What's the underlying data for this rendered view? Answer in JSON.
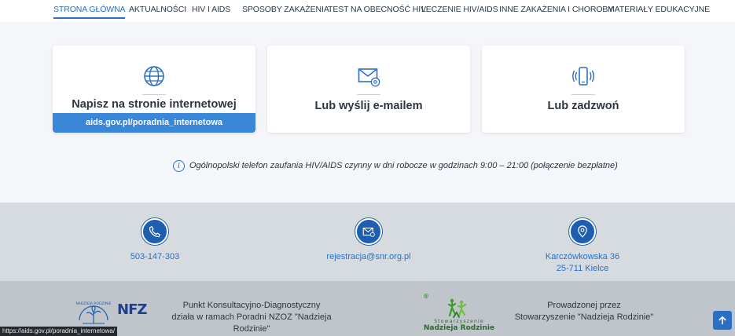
{
  "nav": {
    "items": [
      {
        "label": "STRONA GŁÓWNA",
        "active": true
      },
      {
        "label": "AKTUALNOŚCI"
      },
      {
        "label": "HIV I AIDS"
      },
      {
        "label": "SPOSOBY ZAKAŻENIA"
      },
      {
        "label": "TEST NA OBECNOŚĆ HIV"
      },
      {
        "label": "LECZENIE HIV/AIDS"
      },
      {
        "label": "INNE ZAKAŻENIA I CHOROBY"
      },
      {
        "label": "MATERIAŁY EDUKACYJNE"
      }
    ]
  },
  "cards": [
    {
      "title": "Napisz na stronie internetowej",
      "link": "aids.gov.pl/poradnia_internetowa",
      "icon": "globe-icon"
    },
    {
      "title": "Lub wyślij e-mailem",
      "icon": "email-at-icon"
    },
    {
      "title": "Lub zadzwoń",
      "icon": "phone-vibrate-icon"
    }
  ],
  "info": {
    "text": "Ogólnopolski telefon zaufania HIV/AIDS czynny w dni robocze w godzinach 9:00 – 21:00 (połączenie bezpłatne)",
    "icon": "info-icon"
  },
  "contact": {
    "phone": "503-147-303",
    "email": "rejestracja@snr.org.pl",
    "address_line1": "Karczówkowska 36",
    "address_line2": "25-711 Kielce"
  },
  "footer": {
    "left_line1": "Punkt Konsultacyjno-Diagnostyczny",
    "left_line2": "działa w ramach Poradni NZOZ \"Nadzieja Rodzinie\"",
    "nfz_logo": "NFZ",
    "nzoz_logo_text": "NADZIEJA RODZINIE",
    "snr_logo_line1": "Stowarzyszenie",
    "snr_logo_line2": "Nadzieja Rodzinie",
    "snr_registered": "®",
    "right_line1": "Prowadzonej przez",
    "right_line2": "Stowarzyszenie \"Nadzieja Rodzinie\""
  },
  "status_url": "https://aids.gov.pl/poradnia_internetowa/",
  "colors": {
    "accent": "#2a6fc2",
    "card_link": "#3a87d8",
    "contact_bg": "#d6dbe0",
    "footer_bg": "#bfc5cb"
  }
}
